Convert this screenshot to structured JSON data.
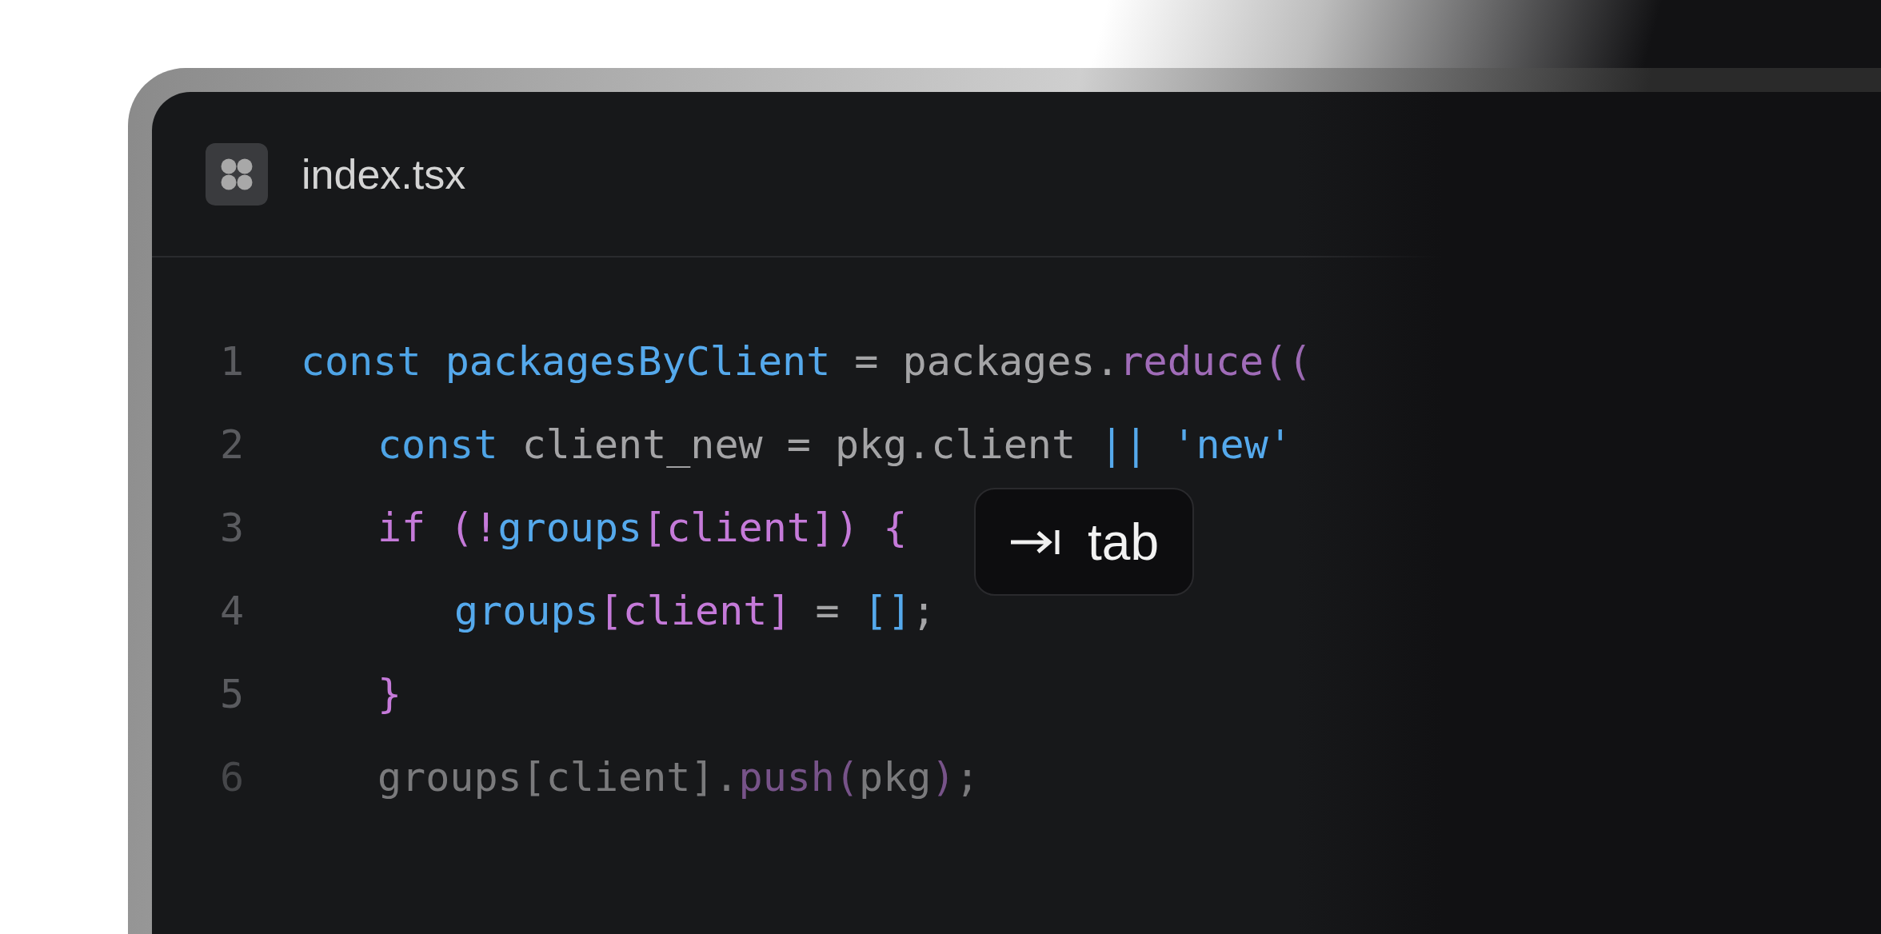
{
  "editor": {
    "file_name": "index.tsx",
    "lines": [
      {
        "number": "1",
        "dim": false,
        "tokens": [
          {
            "kind": "keyword",
            "text": "const "
          },
          {
            "kind": "variable",
            "text": "packagesByClient"
          },
          {
            "kind": "plain",
            "text": " = packages."
          },
          {
            "kind": "function",
            "text": "reduce(("
          }
        ],
        "children": [
          {
            "number": "2",
            "dim": false,
            "tokens": [
              {
                "kind": "keyword",
                "text": "const "
              },
              {
                "kind": "plain",
                "text": "client_new = pkg.client "
              },
              {
                "kind": "variable",
                "text": "|| 'new'"
              }
            ]
          },
          {
            "number": "3",
            "dim": false,
            "tokens": [
              {
                "kind": "control",
                "text": "if (!"
              },
              {
                "kind": "variable",
                "text": "groups"
              },
              {
                "kind": "control",
                "text": "[client]) {"
              }
            ],
            "children": [
              {
                "number": "4",
                "dim": false,
                "tokens": [
                  {
                    "kind": "variable",
                    "text": "groups"
                  },
                  {
                    "kind": "control",
                    "text": "[client]"
                  },
                  {
                    "kind": "plain",
                    "text": " = "
                  },
                  {
                    "kind": "variable",
                    "text": "[]"
                  },
                  {
                    "kind": "plain",
                    "text": ";"
                  }
                ]
              }
            ]
          },
          {
            "number": "5",
            "dim": false,
            "tokens": [
              {
                "kind": "control",
                "text": "}"
              }
            ]
          },
          {
            "number": "6",
            "dim": true,
            "tokens": [
              {
                "kind": "plain",
                "text": "groups[client]."
              },
              {
                "kind": "function",
                "text": "push("
              },
              {
                "kind": "plain",
                "text": "pkg"
              },
              {
                "kind": "function",
                "text": ")"
              },
              {
                "kind": "plain",
                "text": ";"
              }
            ]
          }
        ]
      }
    ],
    "hint": {
      "key": "tab"
    }
  }
}
